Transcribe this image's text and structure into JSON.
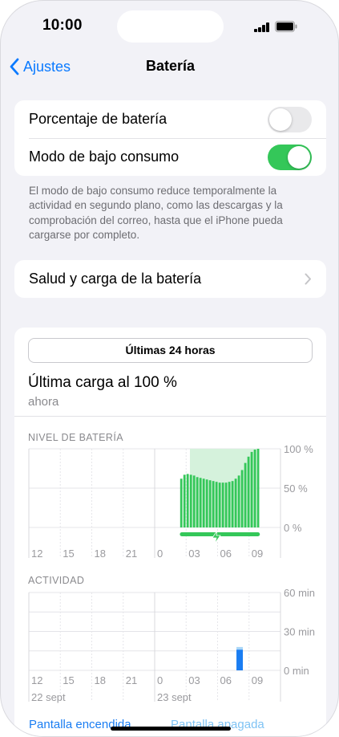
{
  "status_bar": {
    "time": "10:00"
  },
  "nav": {
    "back_label": "Ajustes",
    "title": "Batería"
  },
  "settings": {
    "battery_percentage": {
      "label": "Porcentaje de batería",
      "on": false
    },
    "low_power_mode": {
      "label": "Modo de bajo consumo",
      "on": true
    },
    "footnote": "El modo de bajo consumo reduce temporalmente la actividad en segundo plano, como las descargas y la comprobación del correo, hasta que el iPhone pueda cargarse por completo."
  },
  "health": {
    "label": "Salud y carga de la batería"
  },
  "usage": {
    "range_button": "Últimas 24 horas",
    "last_charge_title": "Última carga al 100 %",
    "last_charge_time": "ahora"
  },
  "colors": {
    "accent": "#0a7aff",
    "green": "#34c759",
    "charge_fill": "#d5f2dc",
    "activity": "#1a7df2"
  },
  "chart_data": [
    {
      "type": "bar",
      "title": "NIVEL DE BATERÍA",
      "x_tick_labels": [
        "12",
        "15",
        "18",
        "21",
        "0",
        "03",
        "06",
        "09"
      ],
      "y_tick_labels": [
        "100 %",
        "50 %",
        "0 %"
      ],
      "ylim": [
        0,
        100
      ],
      "bar_values": [
        62,
        67,
        68,
        67,
        66,
        64,
        63,
        62,
        61,
        60,
        59,
        58,
        57,
        57,
        57,
        58,
        59,
        62,
        66,
        73,
        82,
        90,
        96,
        99,
        100
      ],
      "charging_span_fraction": [
        0.64,
        0.905
      ],
      "grid": true
    },
    {
      "type": "bar",
      "title": "ACTIVIDAD",
      "x_tick_labels": [
        "12",
        "15",
        "18",
        "21",
        "0",
        "03",
        "06",
        "09"
      ],
      "date_labels": [
        "22 sept",
        "23 sept"
      ],
      "y_tick_labels": [
        "60 min",
        "30 min",
        "0 min"
      ],
      "ylim": [
        0,
        60
      ],
      "bars": [
        {
          "slot": 6.6,
          "screen_on": 16,
          "screen_off": 2
        }
      ],
      "legend": [
        "Pantalla encendida",
        "Pantalla apagada"
      ],
      "grid": true
    }
  ]
}
